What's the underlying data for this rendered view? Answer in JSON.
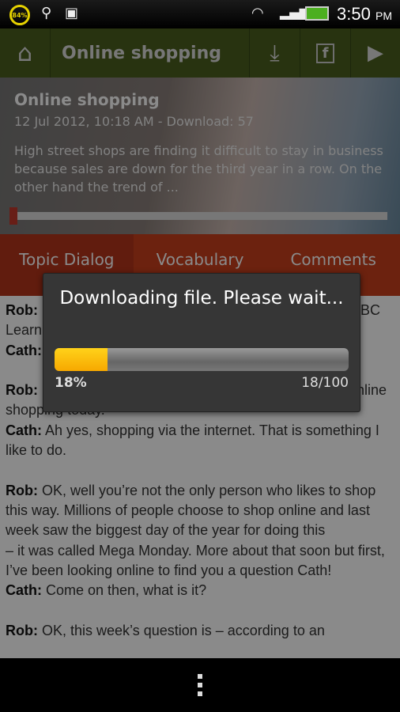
{
  "status_bar": {
    "battery_percent": "84%",
    "time": "3:50",
    "ampm": "PM"
  },
  "appbar": {
    "title": "Online shopping"
  },
  "episode": {
    "title": "Online shopping",
    "meta": "12 Jul 2012, 10:18 AM - Download: 57",
    "description": "High street shops are finding it difficult to stay in business because sales are down for the third year in a row. On the other hand the trend of ...",
    "playback_progress": 0
  },
  "tabs": [
    "Topic Dialog",
    "Vocabulary",
    "Comments"
  ],
  "transcript": {
    "l1_speaker": "Rob:",
    "l1_right": "BC",
    "l2": "Learn",
    "l3_speaker": "Cath:",
    "l4_speaker": "Rob:",
    "l4_right": "nline",
    "l5": "shopping today.",
    "p2_speaker": "Cath:",
    "p2": " Ah yes, shopping via the internet. That is something I like to do.",
    "p3_speaker": "Rob:",
    "p3": " OK, well you’re not the only person who likes to shop this way. Millions of people choose to shop online and last week saw the biggest day of the year for doing this",
    "p3b": "– it was called Mega Monday. More about that soon but first, I’ve been looking online to find you a question Cath!",
    "p4_speaker": "Cath:",
    "p4": " Come on then, what is it?",
    "p5_speaker": "Rob:",
    "p5": " OK, this week’s question is – according to an"
  },
  "dialog": {
    "message": "Downloading file. Please wait...",
    "percent_label": "18%",
    "count_label": "18/100",
    "progress": 0.18
  },
  "colors": {
    "accent": "#f7b500",
    "tab_bar": "#c8401c",
    "appbar": "#4a5e1e"
  }
}
